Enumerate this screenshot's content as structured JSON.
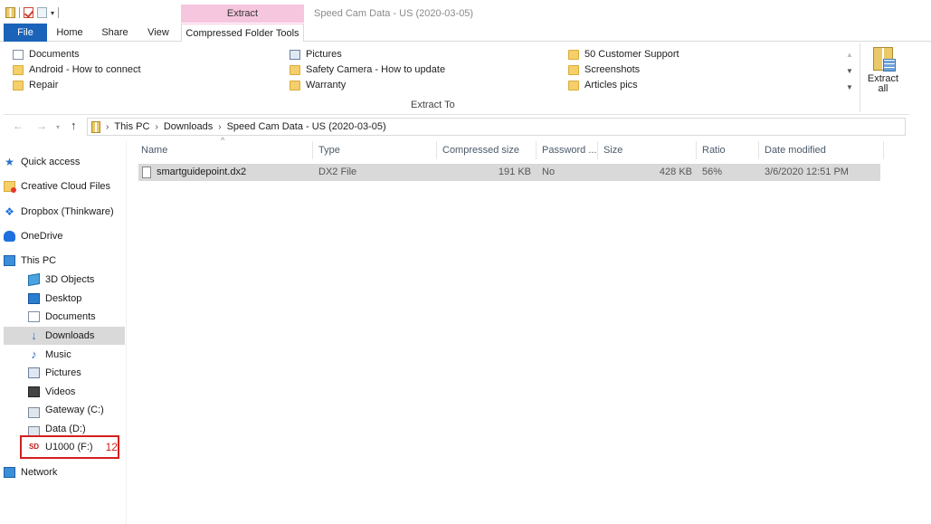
{
  "window": {
    "title": "Speed Cam Data - US (2020-03-05)",
    "context_group": "Extract"
  },
  "quick_access_toolbar": {
    "icons": [
      "zip-folder-icon",
      "properties-icon",
      "new-folder-icon",
      "customize-caret-icon"
    ],
    "customize_caret": "▾"
  },
  "ribbon": {
    "tabs": {
      "file": "File",
      "home": "Home",
      "share": "Share",
      "view": "View",
      "compressed_folder_tools": "Compressed Folder Tools"
    },
    "destinations": [
      {
        "label": "Documents",
        "icon": "document-icon"
      },
      {
        "label": "Pictures",
        "icon": "pictures-icon"
      },
      {
        "label": "50 Customer Support",
        "icon": "folder-icon"
      },
      {
        "label": "Android - How to connect",
        "icon": "folder-icon"
      },
      {
        "label": "Safety Camera - How to update",
        "icon": "folder-icon"
      },
      {
        "label": "Screenshots",
        "icon": "folder-icon"
      },
      {
        "label": "Repair",
        "icon": "folder-icon"
      },
      {
        "label": "Warranty",
        "icon": "folder-icon"
      },
      {
        "label": "Articles pics",
        "icon": "folder-icon"
      }
    ],
    "scroll": {
      "up": "▲",
      "down": "▼",
      "more": "▼"
    },
    "group_label": "Extract To",
    "extract_all_line1": "Extract",
    "extract_all_line2": "all"
  },
  "address_bar": {
    "back": "←",
    "forward": "→",
    "recent": "▾",
    "up": "↑",
    "crumbs": [
      "This PC",
      "Downloads",
      "Speed Cam Data - US (2020-03-05)"
    ],
    "separator": "›"
  },
  "nav_pane": {
    "items": [
      {
        "label": "Quick access",
        "icon": "star-icon",
        "glyph": "★"
      },
      {
        "label": "Creative Cloud Files",
        "icon": "creative-cloud-icon",
        "glyph": ""
      },
      {
        "label": "Dropbox (Thinkware)",
        "icon": "dropbox-icon",
        "glyph": "❖"
      },
      {
        "label": "OneDrive",
        "icon": "onedrive-icon",
        "glyph": ""
      },
      {
        "label": "This PC",
        "icon": "this-pc-icon",
        "glyph": ""
      },
      {
        "label": "3D Objects",
        "icon": "3d-objects-icon",
        "glyph": ""
      },
      {
        "label": "Desktop",
        "icon": "desktop-icon",
        "glyph": ""
      },
      {
        "label": "Documents",
        "icon": "documents-icon",
        "glyph": ""
      },
      {
        "label": "Downloads",
        "icon": "downloads-icon",
        "glyph": "↓"
      },
      {
        "label": "Music",
        "icon": "music-icon",
        "glyph": "♪"
      },
      {
        "label": "Pictures",
        "icon": "pictures-icon",
        "glyph": ""
      },
      {
        "label": "Videos",
        "icon": "videos-icon",
        "glyph": ""
      },
      {
        "label": "Gateway (C:)",
        "icon": "drive-c-icon",
        "glyph": ""
      },
      {
        "label": "Data (D:)",
        "icon": "drive-d-icon",
        "glyph": ""
      },
      {
        "label": "U1000 (F:)",
        "icon": "sd-card-icon",
        "glyph": "SD"
      },
      {
        "label": "Network",
        "icon": "network-icon",
        "glyph": ""
      }
    ],
    "selected": "Downloads",
    "annotation_number": "12"
  },
  "file_list": {
    "sort_indicator": "^",
    "columns": [
      "Name",
      "Type",
      "Compressed size",
      "Password ...",
      "Size",
      "Ratio",
      "Date modified"
    ],
    "rows": [
      {
        "name": "smartguidepoint.dx2",
        "type": "DX2 File",
        "compressed_size": "191 KB",
        "password": "No",
        "size": "428 KB",
        "ratio": "56%",
        "date_modified": "3/6/2020 12:51 PM"
      }
    ]
  }
}
